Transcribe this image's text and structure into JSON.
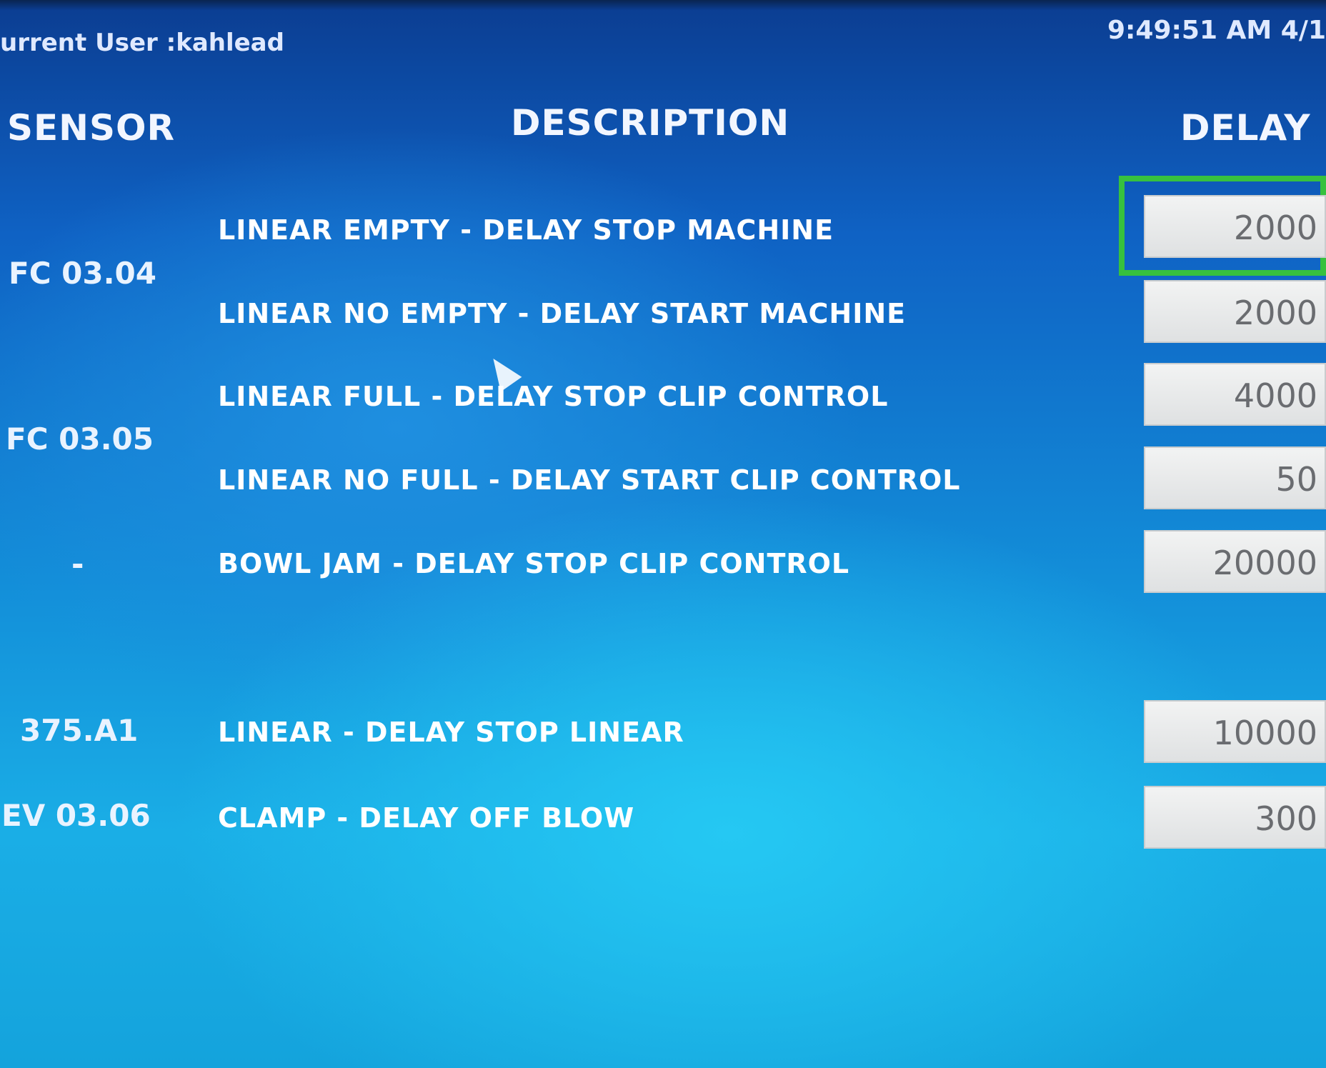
{
  "header": {
    "current_user": "urrent User :kahlead",
    "clock": "9:49:51 AM 4/1"
  },
  "columns": {
    "sensor": "SENSOR",
    "description": "DESCRIPTION",
    "delay": "DELAY"
  },
  "rows": [
    {
      "sensor": "",
      "description": "LINEAR EMPTY - DELAY STOP MACHINE",
      "delay": "2000"
    },
    {
      "sensor": "FC 03.04",
      "description": "",
      "delay": ""
    },
    {
      "sensor": "",
      "description": "LINEAR NO EMPTY - DELAY START MACHINE",
      "delay": "2000"
    },
    {
      "sensor": "",
      "description": "LINEAR FULL - DELAY STOP CLIP CONTROL",
      "delay": "4000"
    },
    {
      "sensor": "FC 03.05",
      "description": "",
      "delay": ""
    },
    {
      "sensor": "",
      "description": "LINEAR NO FULL - DELAY START CLIP CONTROL",
      "delay": "50"
    },
    {
      "sensor": "-",
      "description": "BOWL JAM - DELAY STOP CLIP CONTROL",
      "delay": "20000"
    },
    {
      "sensor": "375.A1",
      "description": "LINEAR - DELAY STOP LINEAR",
      "delay": "10000"
    },
    {
      "sensor": "EV 03.06",
      "description": "CLAMP - DELAY OFF BLOW",
      "delay": "300"
    }
  ],
  "focused_field": "delay-linear-empty",
  "colors": {
    "focus": "#37c13e",
    "field_bg": "#e6e8e9",
    "field_text": "#6a6c70"
  }
}
